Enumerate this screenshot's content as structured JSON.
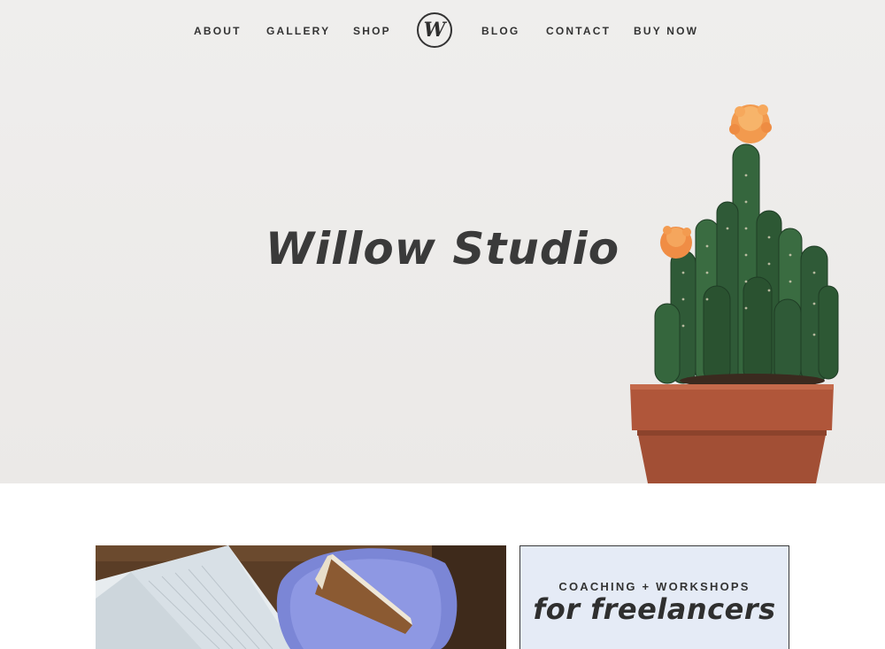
{
  "nav": {
    "left": [
      "ABOUT",
      "GALLERY",
      "SHOP"
    ],
    "logo": "W",
    "right": [
      "BLOG",
      "CONTACT",
      "BUY NOW"
    ]
  },
  "hero": {
    "title": "Willow Studio",
    "image": "potted-cactus-with-orange-flowers"
  },
  "features": {
    "photo": "open-book-and-cake-on-blue-plate",
    "eyebrow": "COACHING + WORKSHOPS",
    "script": "for freelancers"
  },
  "colors": {
    "hero_bg": "#edebe9",
    "text": "#2f2f2f",
    "feature_box_bg": "#e5ebf6",
    "pot": "#b0563a",
    "flower": "#f29a4e"
  }
}
